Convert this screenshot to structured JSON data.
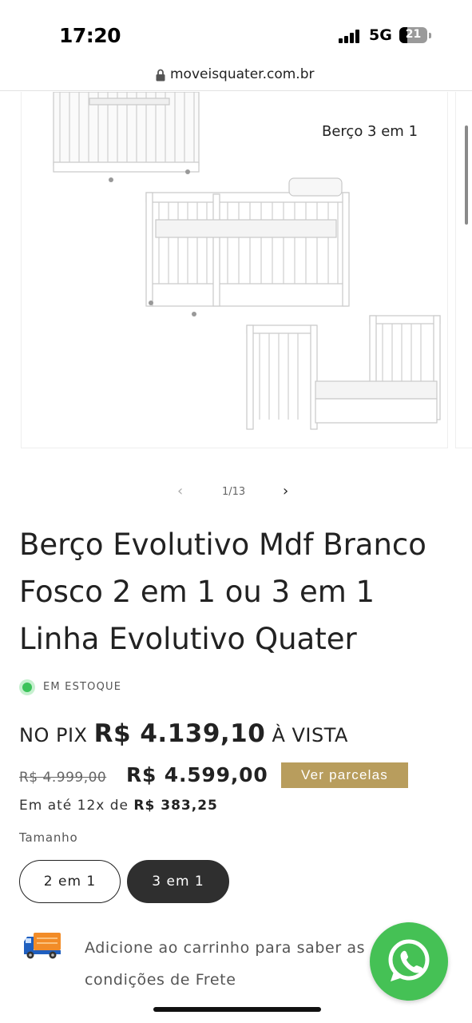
{
  "status_bar": {
    "time": "17:20",
    "network": "5G",
    "battery": "21"
  },
  "browser": {
    "url": "moveisquater.com.br"
  },
  "gallery": {
    "image_caption": "Berço 3 em 1",
    "pager_text": "1/13",
    "prev_icon": "chevron-left-icon",
    "next_icon": "chevron-right-icon"
  },
  "product": {
    "title": "Berço Evolutivo Mdf Branco Fosco 2 em 1 ou 3 em 1 Linha Evolutivo Quater",
    "stock_status": "EM ESTOQUE",
    "pix_prefix": "NO PIX",
    "pix_price": "R$ 4.139,10",
    "pix_suffix": "À VISTA",
    "old_price": "R$ 4.999,00",
    "price": "R$ 4.599,00",
    "installments_button": "Ver parcelas",
    "installments_prefix": "Em até 12x de",
    "installments_value": "R$ 383,25",
    "size_label": "Tamanho",
    "size_options": [
      "2 em 1",
      "3 em 1"
    ],
    "selected_size": "3 em 1",
    "shipping_text": "Adicione ao carrinho para saber as condições de Frete"
  },
  "colors": {
    "accent_gold": "#b89d5d",
    "stock_green": "#3cc35a",
    "whatsapp_green": "#45c155",
    "selected_dark": "#2f2f2f"
  },
  "icons": [
    "lock-icon",
    "truck-icon",
    "whatsapp-icon"
  ]
}
